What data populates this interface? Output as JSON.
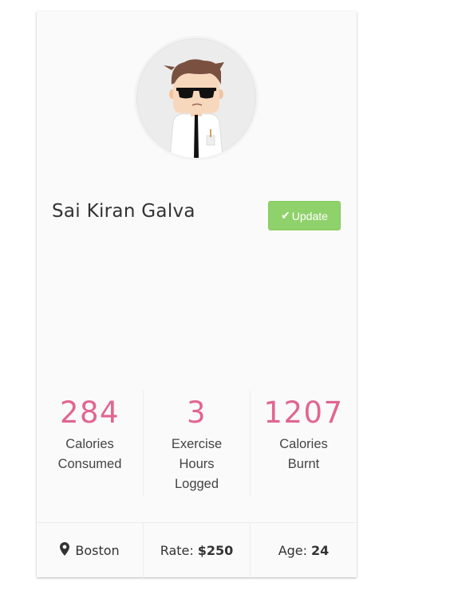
{
  "profile": {
    "name": "Sai Kiran Galva",
    "avatar_icon": "cartoon-avatar-icon",
    "update_label": "Update",
    "update_icon": "check-icon",
    "accent_color": "#e06691",
    "button_color": "#8fd16a"
  },
  "stats": [
    {
      "value": "284",
      "label_lines": [
        "Calories",
        "Consumed"
      ]
    },
    {
      "value": "3",
      "label_lines": [
        "Exercise",
        "Hours",
        "Logged"
      ]
    },
    {
      "value": "1207",
      "label_lines": [
        "Calories",
        "Burnt"
      ]
    }
  ],
  "footer": {
    "location_icon": "map-marker-icon",
    "location": "Boston",
    "rate_label": "Rate:",
    "rate_value": "$250",
    "age_label": "Age:",
    "age_value": "24"
  }
}
